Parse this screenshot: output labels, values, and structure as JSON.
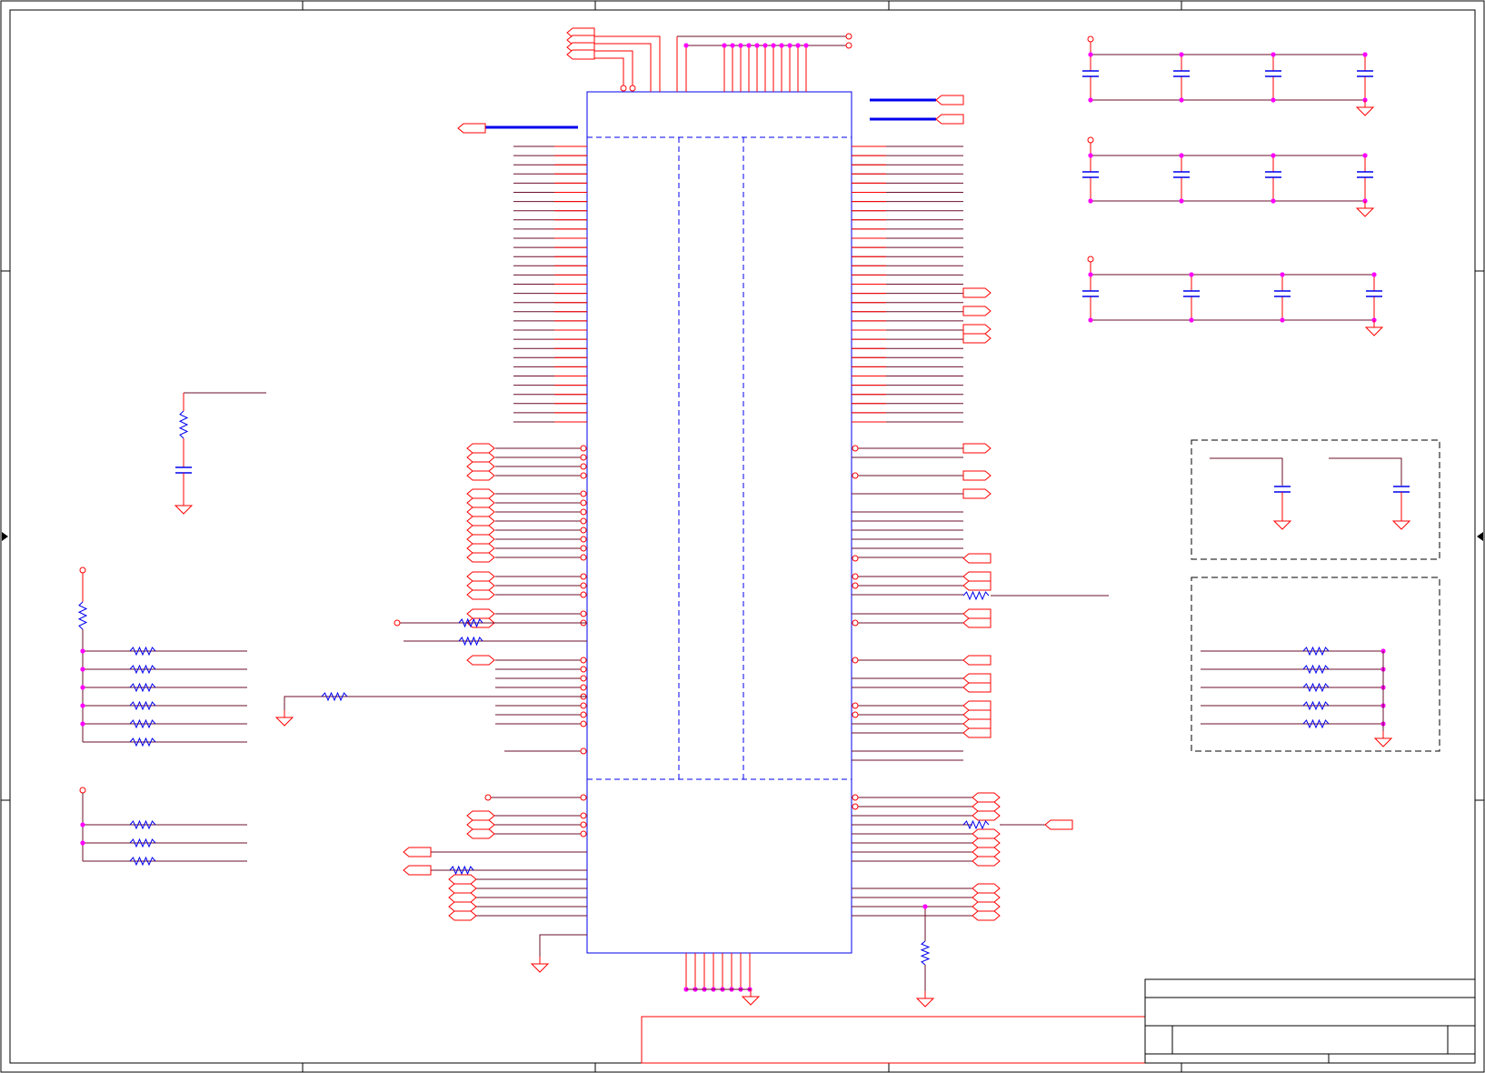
{
  "colors": {
    "frame": "#000000",
    "wire": "#6b0f2a",
    "pin": "#ff0000",
    "body": "#0000ee",
    "junction": "#ff00ff",
    "bus": "#0000ee",
    "component": "#0000ee"
  },
  "icons": {
    "resistor": "resistor-icon",
    "capacitor": "capacitor-icon",
    "ground": "ground-icon",
    "port": "port-icon",
    "power": "power-pin-icon"
  }
}
